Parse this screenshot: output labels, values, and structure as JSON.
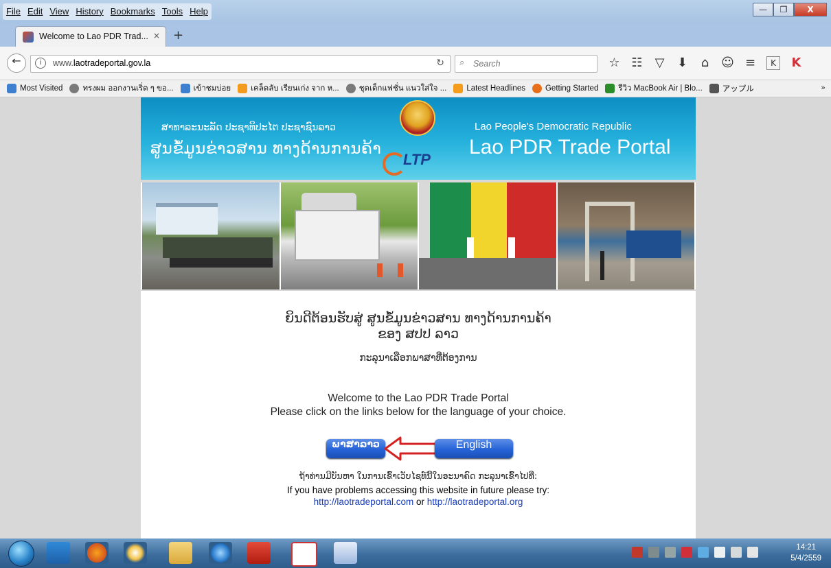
{
  "window": {
    "menu": [
      "File",
      "Edit",
      "View",
      "History",
      "Bookmarks",
      "Tools",
      "Help"
    ],
    "controls": {
      "minimize": "—",
      "maximize": "❐",
      "close": "X"
    }
  },
  "tabs": [
    {
      "title": "Welcome to Lao PDR Trad...",
      "close": "×"
    }
  ],
  "new_tab": "+",
  "nav": {
    "url_prefix": "www.",
    "url_domain": "laotradeportal.gov.la",
    "search_placeholder": "Search"
  },
  "bookmarks": [
    {
      "label": "Most Visited",
      "color": "#3f7fd0"
    },
    {
      "label": "ทรงผม ออกงานเริ่ด ๆ ขอ...",
      "color": "#7a7a7a"
    },
    {
      "label": "เข้าชมบ่อย",
      "color": "#3f7fd0"
    },
    {
      "label": "เคล็ดลับ เรียนเก่ง จาก ห...",
      "color": "#f39b1d"
    },
    {
      "label": "ชุดเด็กแฟชั่น แนวใส่ใจ ...",
      "color": "#7a7a7a"
    },
    {
      "label": "Latest Headlines",
      "color": "#f59c1a"
    },
    {
      "label": "Getting Started",
      "color": "#e8701a"
    },
    {
      "label": "รีวิว MacBook Air | Blo...",
      "color": "#2a8d2a"
    },
    {
      "label": "アップル",
      "color": "#555555"
    }
  ],
  "bookmarks_more": "»",
  "banner": {
    "lao_small": "ສາທາລະນະລັດ ປະຊາທິປະໄຕ ປະຊາຊົນລາວ",
    "lao_big": "ສູນຂໍ້ມູນຂ່າວສານ ທາງດ້ານການຄ້າ",
    "en_small": "Lao People's Democratic Republic",
    "en_big": "Lao PDR Trade Portal",
    "logo_text": "LTP"
  },
  "content": {
    "lao_welcome_1": "ຍິນດີຕ້ອນຮັບສູ່ ສູນຂໍ້ມູນຂ່າວສານ ທາງດ້ານການຄ້າ",
    "lao_welcome_2": "ຂອງ ສປປ ລາວ",
    "lao_choose": "ກະລຸນາເລືອກພາສາທີ່ຕ້ອງການ",
    "en_welcome": "Welcome to the Lao PDR Trade Portal",
    "en_choose": "Please click on the links below for the language of your choice.",
    "btn_lao": "ພາສາລາວ",
    "btn_en": "English",
    "help_lao": "ຖ້າທ່ານມີບັນຫາ ໃນການເຂົ້າເວັບໄຊທ໌ນີ້ໃນອະນາຄົດ ກະລຸນາເຂົ້າໄປທີ່:",
    "help_en": "If you have problems accessing this website in future please try:",
    "link1": "http://laotradeportal.com",
    "link_or": "or",
    "link2": "http://laotradeportal.org"
  },
  "taskbar": {
    "time": "14:21",
    "date": "5/4/2559"
  },
  "colors": {
    "accent_button": "#2563d6",
    "arrow_red": "#d42121",
    "banner_blue": "#0d8ec4"
  }
}
